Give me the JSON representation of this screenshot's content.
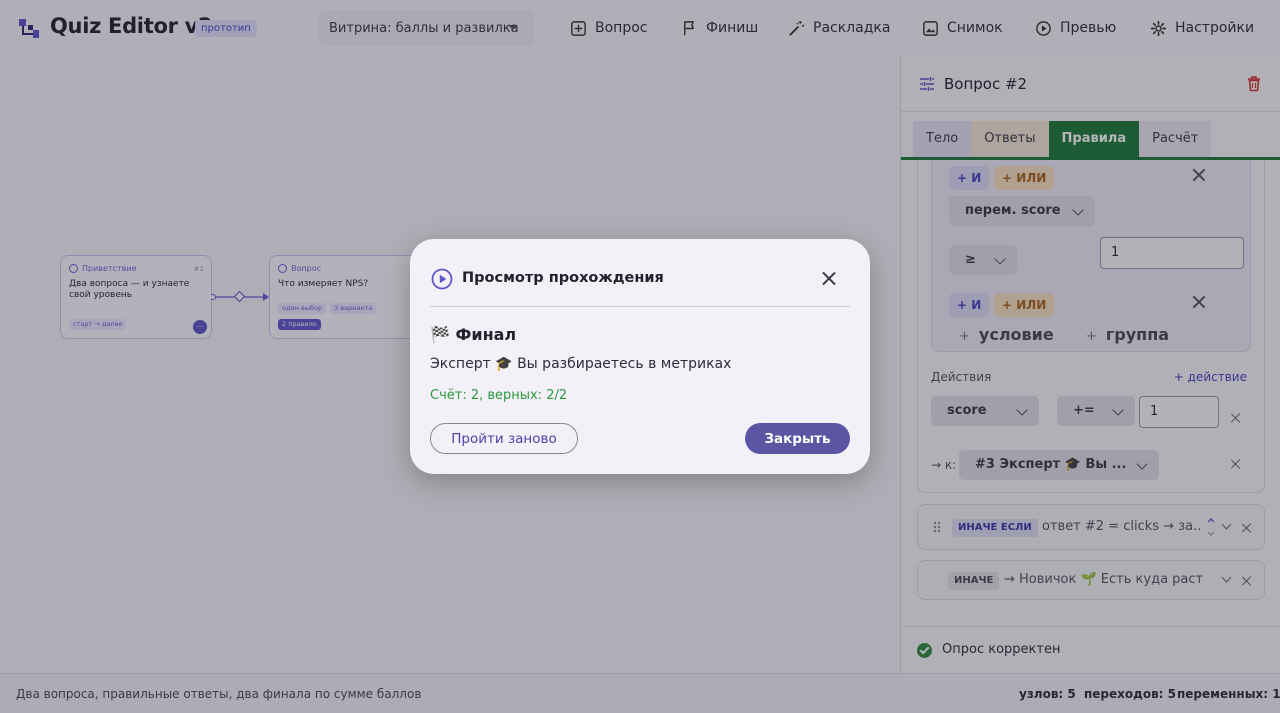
{
  "app": {
    "title": "Quiz Editor v2",
    "badge": "прототип"
  },
  "project": {
    "selected": "Витрина: баллы и развилка"
  },
  "toolbar": {
    "question": "Вопрос",
    "finish": "Финиш",
    "layout": "Раскладка",
    "snapshot": "Снимок",
    "preview": "Превью",
    "settings": "Настройки"
  },
  "canvas": {
    "welcome": {
      "kind": "Приветствие",
      "id": "#1",
      "text": "Два вопроса — и узнаете свой уровень",
      "chip": "старт → далее",
      "port": "···"
    },
    "question": {
      "kind": "Вопрос",
      "text": "Что измеряет NPS?",
      "chips": [
        "один выбор",
        "3 варианта",
        "2 правило"
      ]
    }
  },
  "panel": {
    "title": "Вопрос #2",
    "tabs": [
      "Тело",
      "Ответы",
      "Правила",
      "Расчёт"
    ],
    "group": {
      "and1": "+ И",
      "or1": "+ ИЛИ",
      "var_select": "перем. score",
      "op_select": "≥",
      "value": "1",
      "and2": "+ И",
      "or2": "+ ИЛИ",
      "add_condition": "условие",
      "add_group": "группа"
    },
    "actions_label": "Действия",
    "add_action": "+ действие",
    "action": {
      "var": "score",
      "op": "+=",
      "value": "1"
    },
    "goto": {
      "prefix": "→ к:",
      "target": "#3 Эксперт 🎓 Вы ..."
    },
    "elseif": {
      "tag": "ИНАЧЕ ЕСЛИ",
      "text": "ответ #2 = clicks → за..."
    },
    "else": {
      "tag": "ИНАЧЕ",
      "text": "→ Новичок 🌱 Есть куда расти"
    },
    "status": "Опрос корректен"
  },
  "footer": {
    "description": "Два вопроса, правильные ответы, два финала по сумме баллов",
    "nodes": "узлов: 5",
    "transitions": "переходов: 5",
    "variables": "переменных: 1"
  },
  "modal": {
    "title": "Просмотр прохождения",
    "final_heading": "🏁 Финал",
    "final_text": "Эксперт 🎓 Вы разбираетесь в метриках",
    "score": "Счёт: 2, верных: 2/2",
    "restart": "Пройти заново",
    "close": "Закрыть"
  },
  "colors": {
    "accent": "#5f54cc",
    "success": "#1e7a3a",
    "danger": "#d32f2f",
    "modal_primary": "#5b55a4"
  }
}
